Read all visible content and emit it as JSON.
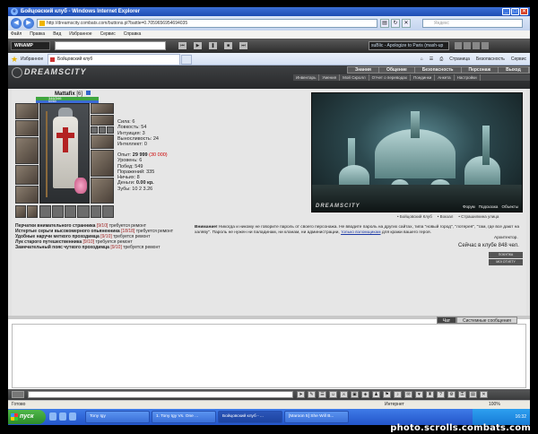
{
  "window": {
    "title": "Бойцовский клуб - Windows Internet Explorer",
    "url": "http://dreamscity.combats.com/buttons.pl?battle=0.7059656954694035",
    "search_placeholder": "Яндекс",
    "min": "_",
    "max": "□",
    "close": "×"
  },
  "menu": [
    "Файл",
    "Правка",
    "Вид",
    "Избранное",
    "Сервис",
    "Справка"
  ],
  "winamp": {
    "logo": "WINAMP",
    "track": "suBlic - Apologize to Paris (mash-up"
  },
  "favorites": {
    "label": "Избранное",
    "tab": "Бойцовский клуб",
    "commands": [
      "Страница",
      "Безопасность",
      "Сервис"
    ]
  },
  "game": {
    "logo": "DREAMSCITY",
    "topnav": [
      "Знания",
      "Общение",
      "Безопасность",
      "Персонаж",
      "Выход"
    ],
    "subnav": [
      "Инвентарь",
      "Умения",
      "Мой Скролл",
      "Отчет о переводах",
      "Поединки",
      "Анкета",
      "Настройки"
    ],
    "character": {
      "name": "Mattafix",
      "level": "[6]",
      "hp": "346/346",
      "mp": "60/60"
    },
    "stats": [
      "Сила: 6",
      "Ловкость: 54",
      "Интуиция: 3",
      "Выносливость: 24",
      "Интеллект: 0"
    ],
    "exp_label": "Опыт:",
    "exp": "29 999",
    "exp_next": "(30 000)",
    "stats2": [
      "Уровень: 6",
      "Побед: 549",
      "Поражений: 335",
      "Ничьих: 8"
    ],
    "money_label": "Деньги:",
    "money": "0.00 кр.",
    "teeth": "Зубы: 10 2 3.26",
    "equipment": [
      {
        "name": "Перчатки внимательного странника",
        "dur": "[9/10]",
        "note": "требуется ремонт"
      },
      {
        "name": "Истертые серьги высокомерного опьяненника",
        "dur": "[18/18]",
        "note": "требуется ремонт"
      },
      {
        "name": "Удобные наручи меткого проходимца",
        "dur": "[9/10]",
        "note": "требуется ремонт"
      },
      {
        "name": "Лук старого путешественника",
        "dur": "[9/10]",
        "note": "требуется ремонт"
      },
      {
        "name": "Замечательный пояс чуткого проходимца",
        "dur": "[9/10]",
        "note": "требуется ремонт"
      }
    ],
    "scene": {
      "label": "DREAMSCITY",
      "menu": [
        "Форум",
        "Подсказка",
        "Объекты"
      ]
    },
    "locnav": [
      "Бойцовский Клуб",
      "Вокзал",
      "Страшилкина улица"
    ],
    "notice": {
      "prefix": "Внимание!",
      "text": "Никогда и никому не говорите пароль от своего персонажа. Не вводите пароль на других сайтах, типа \"новый город\", \"лотерея\", \"там, где все дают на халяву\". Пароль не нужен ни паладинам, ни кланам, ни администрации,",
      "link": "только взломщикам",
      "suffix": "для кражи вашего героя."
    },
    "archlink": "Архитектор.",
    "online": "Сейчас в клубе 848 чел.",
    "badges": [
      "ПОКУПКА СНАРЯЖЕНИЯ",
      "MOI OTVETY"
    ]
  },
  "chat": {
    "tabs": [
      "Чат",
      "Системные сообщения"
    ]
  },
  "status": {
    "left": "Готово",
    "zone": "Интернет",
    "zoom": "100%"
  },
  "taskbar": {
    "start": "пуск",
    "tasks": [
      "Tony Igy",
      "1. Tony Igy Vs. One ...",
      "Бойцовский клуб - ...",
      "[Maroon 5] She Will B..."
    ],
    "clock": "16:32"
  },
  "watermark": "photo.scrolls.combats.com"
}
